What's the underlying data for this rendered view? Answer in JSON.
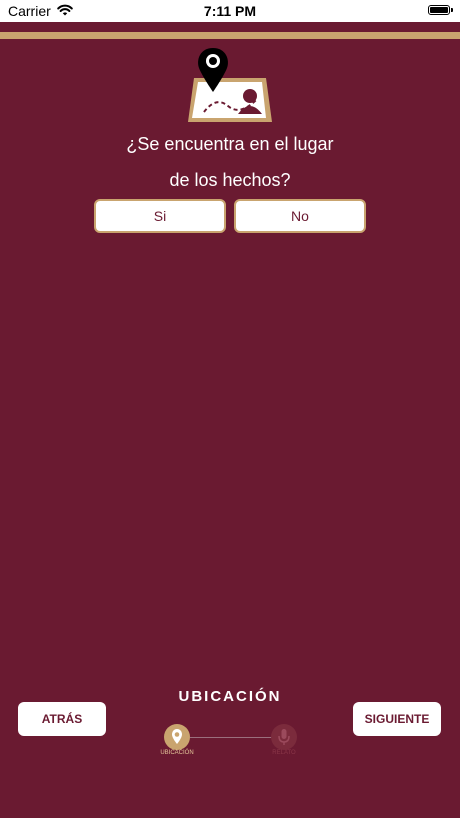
{
  "status_bar": {
    "carrier": "Carrier",
    "time": "7:11 PM"
  },
  "question": {
    "line1": "¿Se encuentra en el lugar",
    "line2": "de los hechos?"
  },
  "answers": {
    "yes": "Si",
    "no": "No"
  },
  "footer": {
    "section_title": "UBICACIÓN",
    "back_label": "ATRÁS",
    "next_label": "SIGUIENTE",
    "steps": [
      {
        "label": "UBICACIÓN",
        "active": true
      },
      {
        "label": "RELATO",
        "active": false
      }
    ]
  },
  "colors": {
    "background": "#6a1a31",
    "accent_gold": "#c9a46f",
    "button_text": "#6a1a31"
  },
  "icons": {
    "status": [
      "wifi-icon",
      "battery-icon"
    ],
    "header": "map-location-icon",
    "steps": [
      "location-pin-icon",
      "microphone-icon"
    ]
  }
}
